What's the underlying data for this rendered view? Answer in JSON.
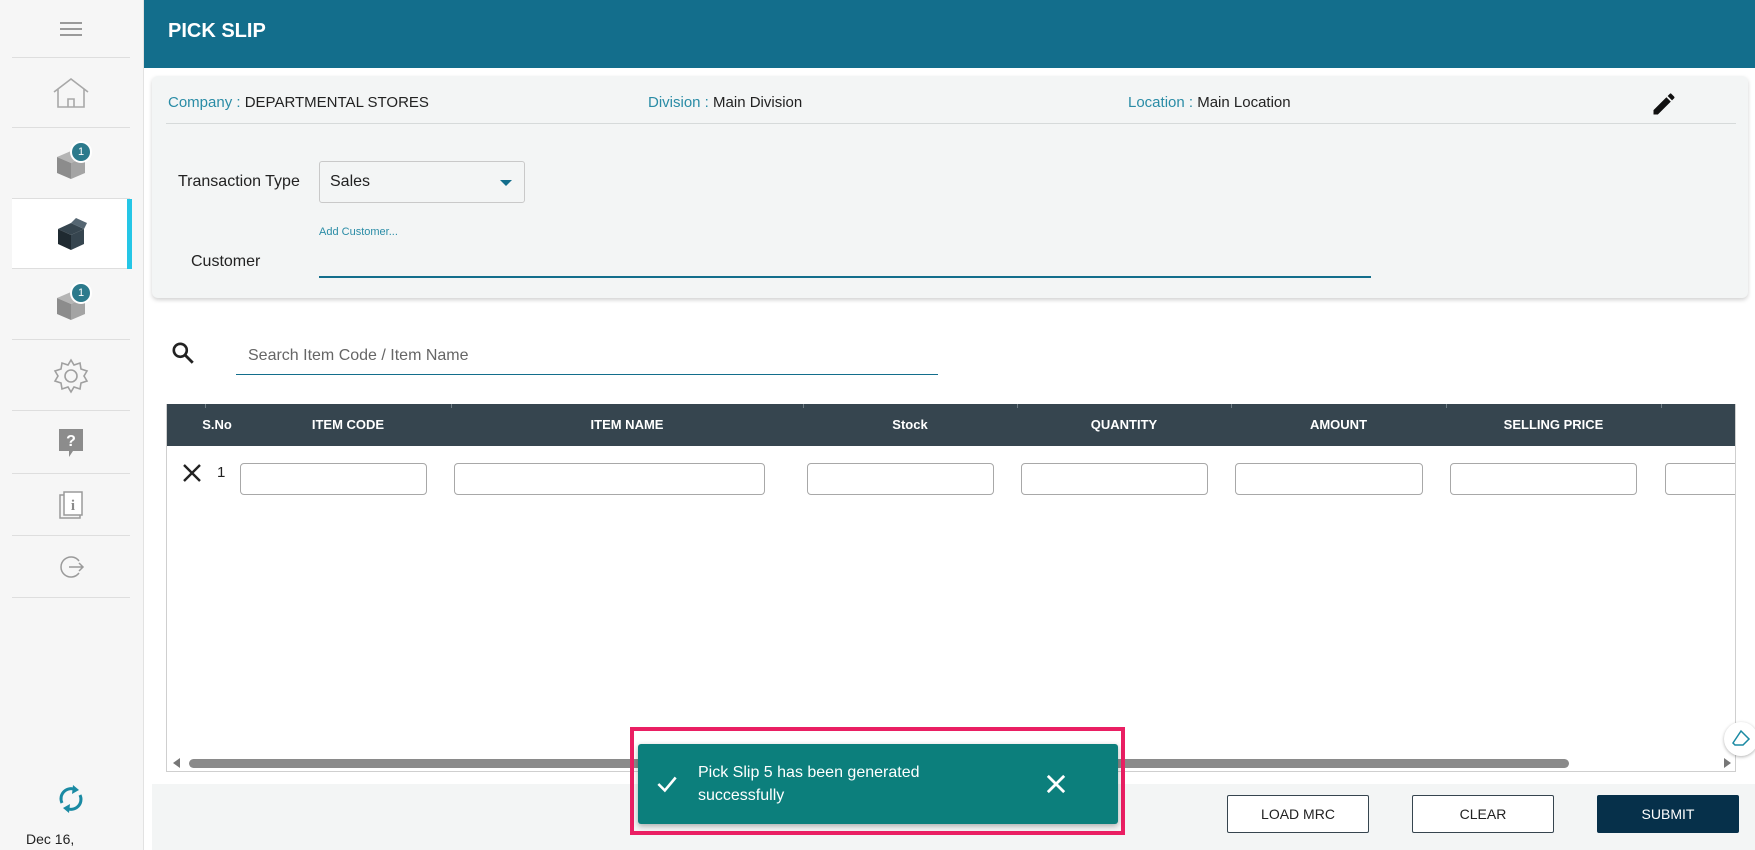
{
  "header": {
    "title": "PICK SLIP"
  },
  "sidebar": {
    "items": [
      {
        "name": "home",
        "icon": "home-icon"
      },
      {
        "name": "inbound",
        "icon": "box-icon",
        "badge": "1"
      },
      {
        "name": "pick-slip",
        "icon": "open-box-icon",
        "active": true
      },
      {
        "name": "outbound",
        "icon": "box-icon",
        "badge": "1"
      },
      {
        "name": "settings",
        "icon": "gear-icon"
      },
      {
        "name": "help",
        "icon": "help-icon"
      },
      {
        "name": "info",
        "icon": "info-icon"
      },
      {
        "name": "logout",
        "icon": "logout-icon"
      }
    ],
    "date": "Dec 16,"
  },
  "info": {
    "company_label": "Company :",
    "company_value": "DEPARTMENTAL STORES",
    "division_label": "Division :",
    "division_value": "Main Division",
    "location_label": "Location :",
    "location_value": "Main Location"
  },
  "form": {
    "transaction_type_label": "Transaction Type",
    "transaction_type_value": "Sales",
    "customer_label": "Customer",
    "customer_hint": "Add Customer..."
  },
  "search": {
    "placeholder": "Search Item Code / Item Name"
  },
  "table": {
    "columns": [
      "S.No",
      "ITEM CODE",
      "ITEM NAME",
      "Stock",
      "QUANTITY",
      "AMOUNT",
      "SELLING PRICE"
    ],
    "rows": [
      {
        "sno": "1"
      }
    ]
  },
  "buttons": {
    "load_mrc": "LOAD MRC",
    "clear": "CLEAR",
    "submit": "SUBMIT"
  },
  "toast": {
    "message": "Pick Slip 5 has been generated successfully"
  },
  "colors": {
    "header": "#136e8c",
    "table_header": "#36454f",
    "toast": "#0c7f7c",
    "highlight": "#ea1f63",
    "accent": "#25c6e6"
  }
}
